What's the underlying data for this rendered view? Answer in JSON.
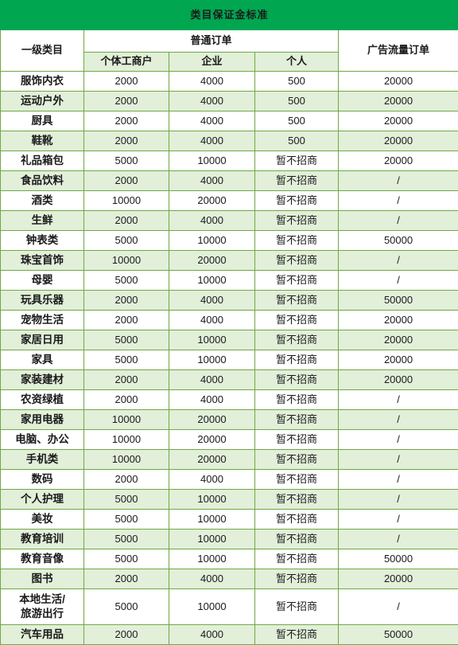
{
  "title": "类目保证金标准",
  "colors": {
    "banner": "#00A650",
    "border": "#6FA845",
    "row_alt": "#E2EFD9",
    "row_base": "#FFFFFF",
    "text": "#1A1A1A"
  },
  "header": {
    "category_label": "一级类目",
    "normal_order_group": "普通订单",
    "ad_traffic_order": "广告流量订单",
    "sub_columns": [
      "个体工商户",
      "企业",
      "个人"
    ]
  },
  "rows": [
    {
      "category": "服饰内衣",
      "individual": "2000",
      "enterprise": "4000",
      "person": "500",
      "ad": "20000"
    },
    {
      "category": "运动户外",
      "individual": "2000",
      "enterprise": "4000",
      "person": "500",
      "ad": "20000"
    },
    {
      "category": "厨具",
      "individual": "2000",
      "enterprise": "4000",
      "person": "500",
      "ad": "20000"
    },
    {
      "category": "鞋靴",
      "individual": "2000",
      "enterprise": "4000",
      "person": "500",
      "ad": "20000"
    },
    {
      "category": "礼品箱包",
      "individual": "5000",
      "enterprise": "10000",
      "person": "暂不招商",
      "ad": "20000"
    },
    {
      "category": "食品饮料",
      "individual": "2000",
      "enterprise": "4000",
      "person": "暂不招商",
      "ad": "/"
    },
    {
      "category": "酒类",
      "individual": "10000",
      "enterprise": "20000",
      "person": "暂不招商",
      "ad": "/"
    },
    {
      "category": "生鲜",
      "individual": "2000",
      "enterprise": "4000",
      "person": "暂不招商",
      "ad": "/"
    },
    {
      "category": "钟表类",
      "individual": "5000",
      "enterprise": "10000",
      "person": "暂不招商",
      "ad": "50000"
    },
    {
      "category": "珠宝首饰",
      "individual": "10000",
      "enterprise": "20000",
      "person": "暂不招商",
      "ad": "/"
    },
    {
      "category": "母婴",
      "individual": "5000",
      "enterprise": "10000",
      "person": "暂不招商",
      "ad": "/"
    },
    {
      "category": "玩具乐器",
      "individual": "2000",
      "enterprise": "4000",
      "person": "暂不招商",
      "ad": "50000"
    },
    {
      "category": "宠物生活",
      "individual": "2000",
      "enterprise": "4000",
      "person": "暂不招商",
      "ad": "20000"
    },
    {
      "category": "家居日用",
      "individual": "5000",
      "enterprise": "10000",
      "person": "暂不招商",
      "ad": "20000"
    },
    {
      "category": "家具",
      "individual": "5000",
      "enterprise": "10000",
      "person": "暂不招商",
      "ad": "20000"
    },
    {
      "category": "家装建材",
      "individual": "2000",
      "enterprise": "4000",
      "person": "暂不招商",
      "ad": "20000"
    },
    {
      "category": "农资绿植",
      "individual": "2000",
      "enterprise": "4000",
      "person": "暂不招商",
      "ad": "/"
    },
    {
      "category": "家用电器",
      "individual": "10000",
      "enterprise": "20000",
      "person": "暂不招商",
      "ad": "/"
    },
    {
      "category": "电脑、办公",
      "individual": "10000",
      "enterprise": "20000",
      "person": "暂不招商",
      "ad": "/"
    },
    {
      "category": "手机类",
      "individual": "10000",
      "enterprise": "20000",
      "person": "暂不招商",
      "ad": "/"
    },
    {
      "category": "数码",
      "individual": "2000",
      "enterprise": "4000",
      "person": "暂不招商",
      "ad": "/"
    },
    {
      "category": "个人护理",
      "individual": "5000",
      "enterprise": "10000",
      "person": "暂不招商",
      "ad": "/"
    },
    {
      "category": "美妆",
      "individual": "5000",
      "enterprise": "10000",
      "person": "暂不招商",
      "ad": "/"
    },
    {
      "category": "教育培训",
      "individual": "5000",
      "enterprise": "10000",
      "person": "暂不招商",
      "ad": "/"
    },
    {
      "category": "教育音像",
      "individual": "5000",
      "enterprise": "10000",
      "person": "暂不招商",
      "ad": "50000"
    },
    {
      "category": "图书",
      "individual": "2000",
      "enterprise": "4000",
      "person": "暂不招商",
      "ad": "20000"
    },
    {
      "category": "本地生活/\n旅游出行",
      "category_lines": [
        "本地生活/",
        "旅游出行"
      ],
      "individual": "5000",
      "enterprise": "10000",
      "person": "暂不招商",
      "ad": "/"
    },
    {
      "category": "汽车用品",
      "individual": "2000",
      "enterprise": "4000",
      "person": "暂不招商",
      "ad": "50000"
    }
  ]
}
